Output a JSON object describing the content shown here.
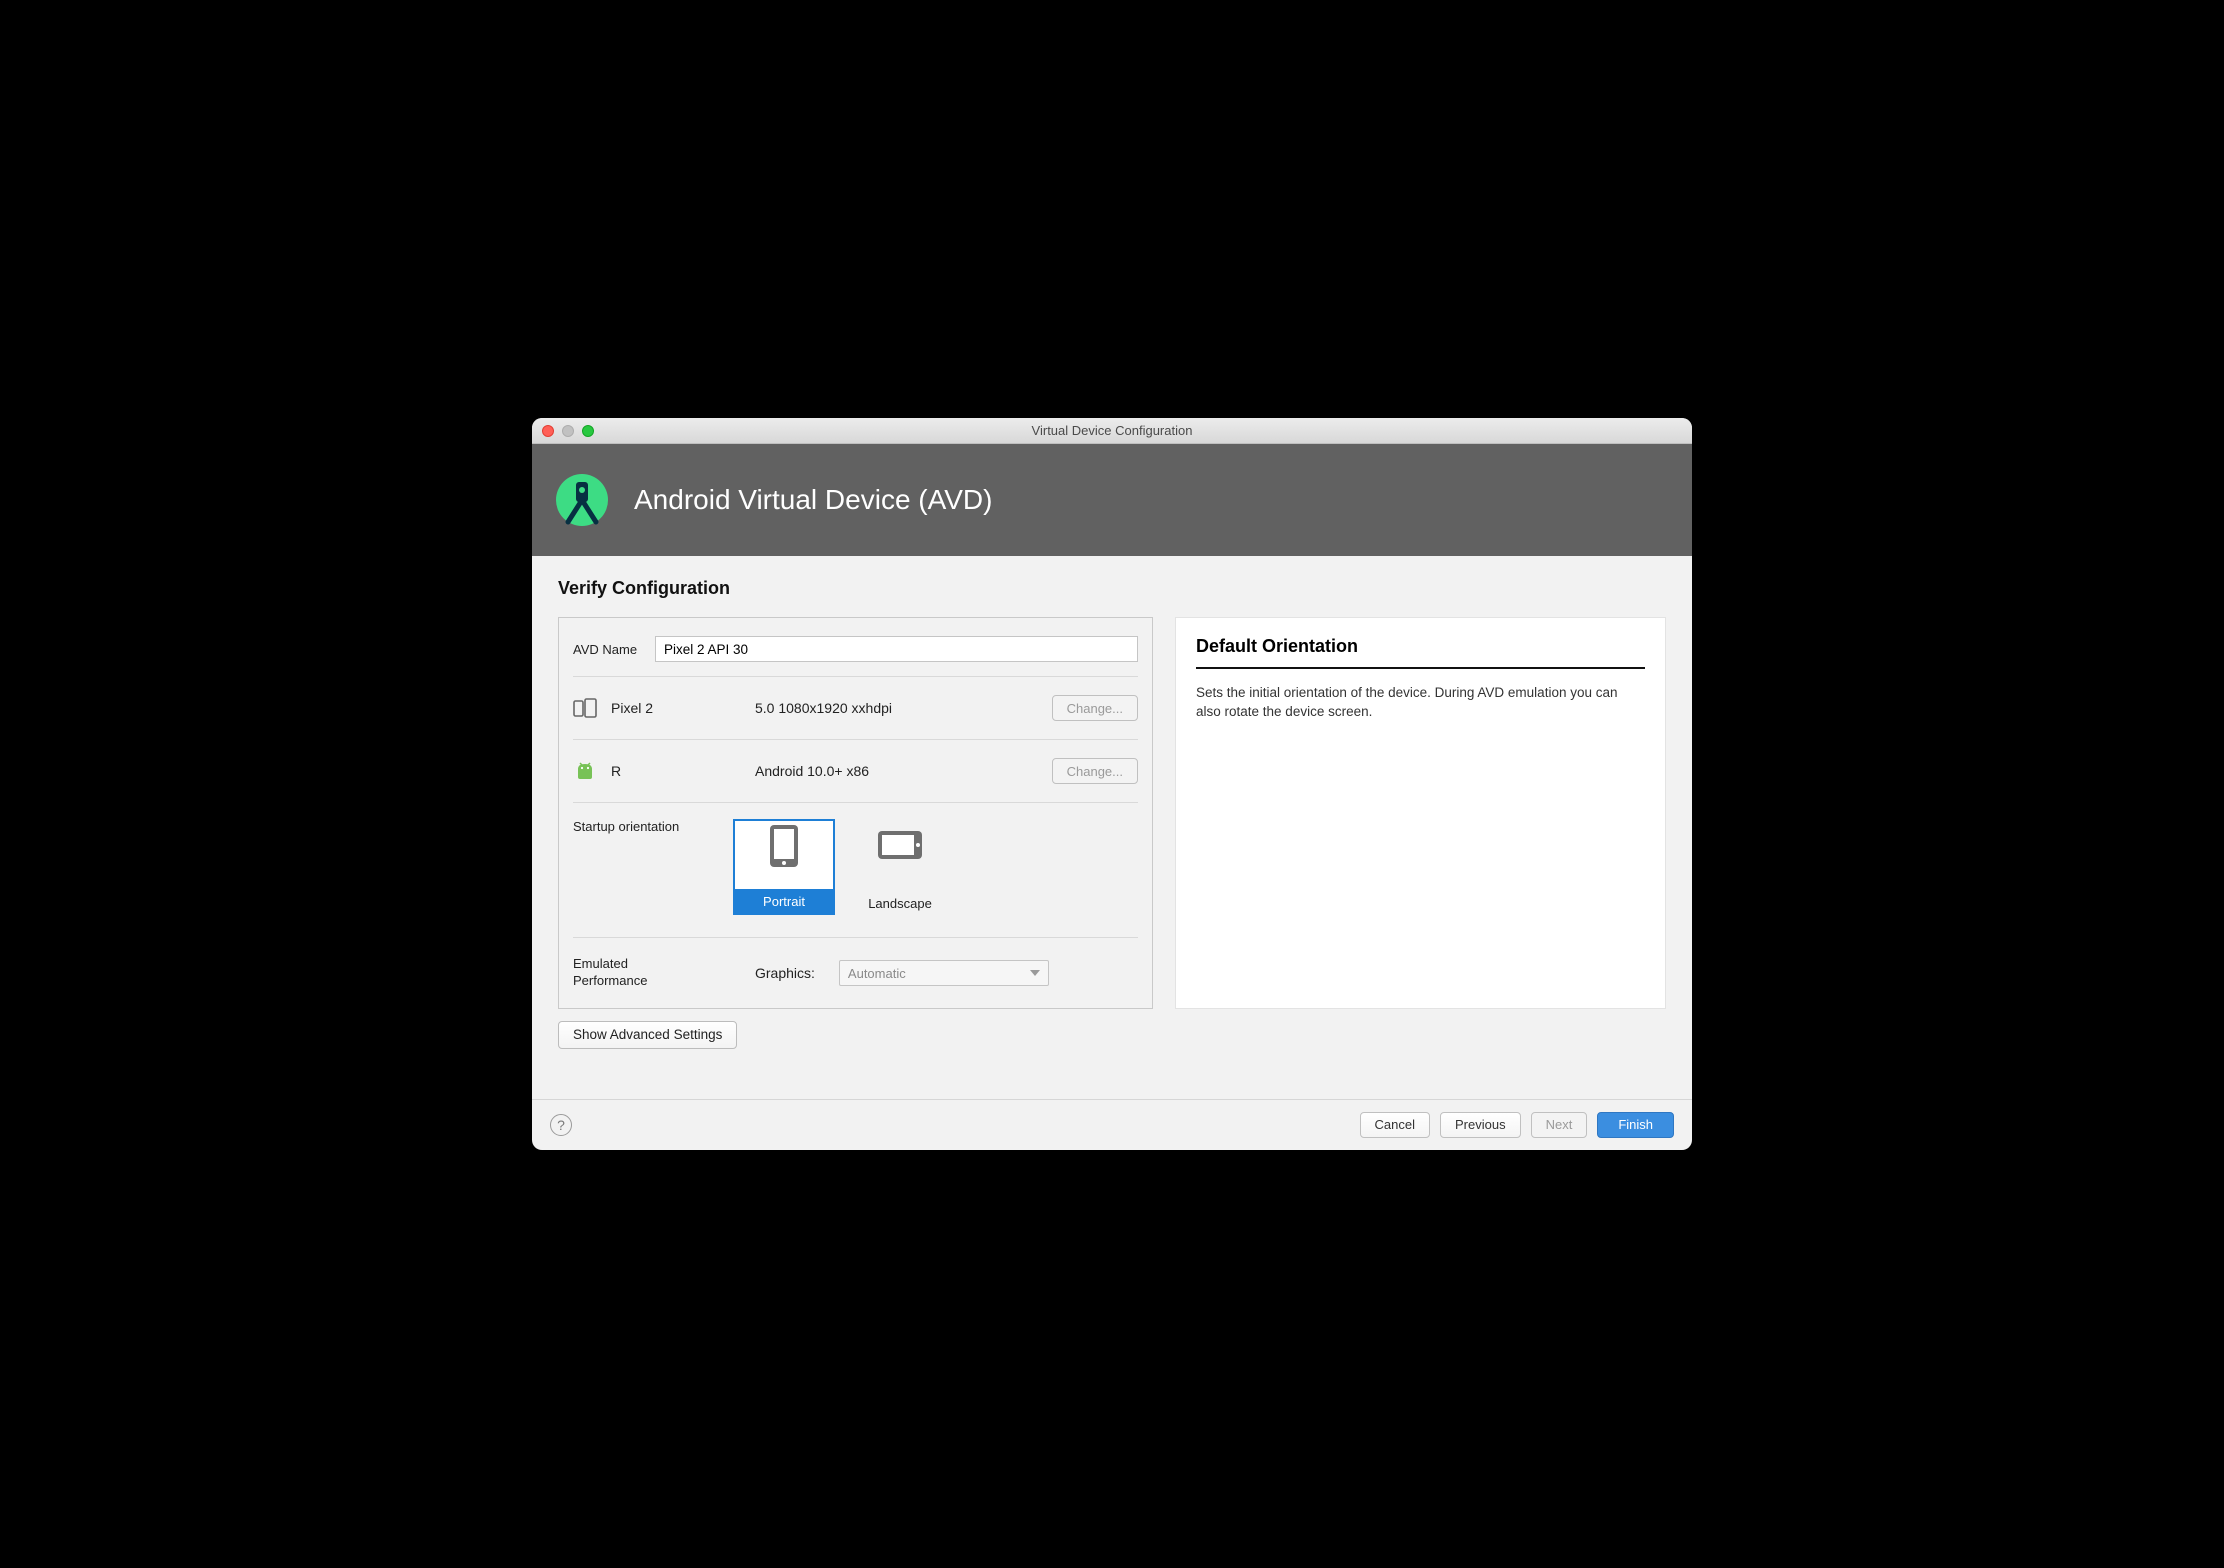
{
  "window": {
    "title": "Virtual Device Configuration"
  },
  "banner": {
    "title": "Android Virtual Device (AVD)"
  },
  "section": {
    "title": "Verify Configuration"
  },
  "avd": {
    "label": "AVD Name",
    "value": "Pixel 2 API 30"
  },
  "device": {
    "name": "Pixel 2",
    "detail": "5.0 1080x1920 xxhdpi",
    "change": "Change..."
  },
  "image": {
    "name": "R",
    "detail": "Android 10.0+ x86",
    "change": "Change..."
  },
  "orientation": {
    "label": "Startup orientation",
    "options": {
      "portrait": "Portrait",
      "landscape": "Landscape"
    },
    "selected": "portrait"
  },
  "graphics": {
    "group_label": "Emulated\nPerformance",
    "sub_label": "Graphics:",
    "value": "Automatic"
  },
  "advanced": {
    "button": "Show Advanced Settings"
  },
  "info": {
    "title": "Default Orientation",
    "body": "Sets the initial orientation of the device. During AVD emulation you can also rotate the device screen."
  },
  "footer": {
    "cancel": "Cancel",
    "previous": "Previous",
    "next": "Next",
    "finish": "Finish"
  }
}
